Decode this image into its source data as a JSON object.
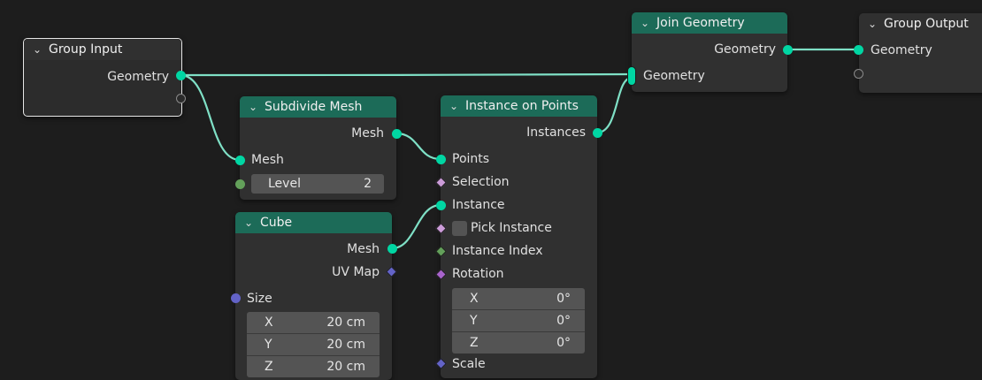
{
  "colors": {
    "background": "#1d1d1d",
    "node_body": "#303030",
    "header_geometry": "#1c6b58",
    "link": "#7fe0c6",
    "geometry_socket": "#00d6a3",
    "float_socket": "#63a05a",
    "vector_socket": "#6363c7",
    "rotation_socket": "#a863cc",
    "boolean_socket": "#cc9cd9"
  },
  "nodes": {
    "group_input": {
      "title": "Group Input",
      "geometry": "Geometry"
    },
    "subdivide": {
      "title": "Subdivide Mesh",
      "mesh_out": "Mesh",
      "mesh_in": "Mesh",
      "level_label": "Level",
      "level_value": "2"
    },
    "cube": {
      "title": "Cube",
      "mesh": "Mesh",
      "uvmap": "UV Map",
      "size": "Size",
      "x_label": "X",
      "x_value": "20 cm",
      "y_label": "Y",
      "y_value": "20 cm",
      "z_label": "Z",
      "z_value": "20 cm"
    },
    "instance_on_points": {
      "title": "Instance on Points",
      "instances": "Instances",
      "points": "Points",
      "selection": "Selection",
      "instance": "Instance",
      "pick_instance": "Pick Instance",
      "instance_index": "Instance Index",
      "rotation": "Rotation",
      "rx_label": "X",
      "rx_value": "0°",
      "ry_label": "Y",
      "ry_value": "0°",
      "rz_label": "Z",
      "rz_value": "0°",
      "scale": "Scale"
    },
    "join_geometry": {
      "title": "Join Geometry",
      "geometry_out": "Geometry",
      "geometry_in": "Geometry"
    },
    "group_output": {
      "title": "Group Output",
      "geometry": "Geometry"
    }
  },
  "icons": {
    "collapse": "chevron-down-icon"
  }
}
